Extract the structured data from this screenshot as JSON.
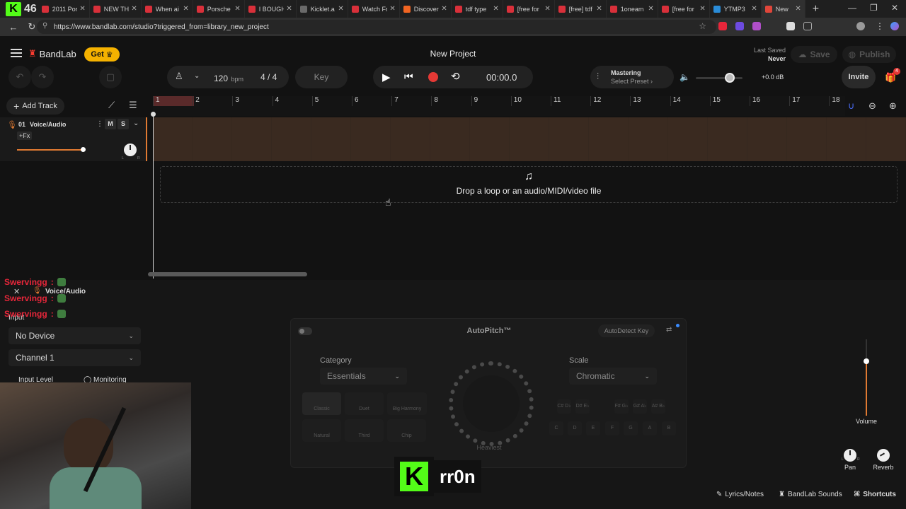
{
  "browser": {
    "tab_count": "46",
    "tabs": [
      {
        "title": "2011 Por",
        "color": "#d9303a"
      },
      {
        "title": "NEW TH",
        "color": "#d9303a"
      },
      {
        "title": "When ai",
        "color": "#d9303a"
      },
      {
        "title": "Porsche",
        "color": "#d9303a"
      },
      {
        "title": "I BOUGH",
        "color": "#d9303a"
      },
      {
        "title": "Kicklet.a",
        "color": "#6a6a6a"
      },
      {
        "title": "Watch Fr",
        "color": "#d9303a"
      },
      {
        "title": "Discover",
        "color": "#f26522"
      },
      {
        "title": "tdf type",
        "color": "#d9303a"
      },
      {
        "title": "[free for",
        "color": "#d9303a"
      },
      {
        "title": "[free] tdf",
        "color": "#d9303a"
      },
      {
        "title": "1oneam",
        "color": "#d9303a"
      },
      {
        "title": "[free for",
        "color": "#d9303a"
      },
      {
        "title": "YTMP3",
        "color": "#2a8cd8"
      },
      {
        "title": "New",
        "color": "#e0463a"
      }
    ],
    "url": "https://www.bandlab.com/studio?triggered_from=library_new_project"
  },
  "app": {
    "brand": "BandLab",
    "get_label": "Get",
    "project_title": "New Project",
    "last_saved_label": "Last Saved",
    "last_saved_value": "Never",
    "save_label": "Save",
    "publish_label": "Publish",
    "invite_label": "Invite",
    "gift_badge": "4"
  },
  "toolbar": {
    "tempo": "120",
    "tempo_unit": "bpm",
    "time_sig": "4 / 4",
    "key_label": "Key",
    "time": "00:00.0",
    "mastering_label": "Mastering",
    "mastering_preset": "Select Preset",
    "volume_db": "+0.0 dB",
    "volume_level": 0.72
  },
  "tracks": {
    "add_track_label": "Add Track",
    "ruler": [
      "1",
      "2",
      "3",
      "4",
      "5",
      "6",
      "7",
      "8",
      "9",
      "10",
      "11",
      "12",
      "13",
      "14",
      "15",
      "16",
      "17",
      "18"
    ],
    "track1_number": "01",
    "track1_name": "Voice/Audio",
    "mute_label": "M",
    "solo_label": "S",
    "fx_label": "+Fx",
    "drop_text": "Drop a loop or an audio/MIDI/video file"
  },
  "panel": {
    "track_label": "Voice/Audio",
    "input_label": "Input",
    "device": "No Device",
    "channel": "Channel 1",
    "input_level_label": "Input Level",
    "monitor_label": "Monitoring",
    "autopitch_title": "AutoPitch™",
    "autodetect_label": "AutoDetect Key",
    "category_label": "Category",
    "category_value": "Essentials",
    "scale_label": "Scale",
    "scale_value": "Chromatic",
    "effects": [
      "Classic",
      "Duet",
      "Big Harmony",
      "Natural",
      "Third",
      "Chip"
    ],
    "sharps": [
      "C#\nD♭",
      "D#\nE♭",
      "F#\nG♭",
      "G#\nA♭",
      "A#\nB♭"
    ],
    "notes": [
      "C",
      "D",
      "E",
      "F",
      "G",
      "A",
      "B"
    ],
    "dial_label": "Heaviest",
    "volume_label": "Volume",
    "pan_label": "Pan",
    "reverb_label": "Reverb",
    "pan_l": "L",
    "pan_r": "R",
    "lyrics_label": "Lyrics/Notes",
    "sounds_label": "BandLab Sounds",
    "shortcuts_label": "Shortcuts"
  },
  "stream": {
    "chat": [
      {
        "user": "Swervingg",
        "sep": ":"
      },
      {
        "user": "Swervingg",
        "sep": ":"
      },
      {
        "user": "Swervingg",
        "sep": ":"
      }
    ],
    "kick_user": "rr0n"
  }
}
